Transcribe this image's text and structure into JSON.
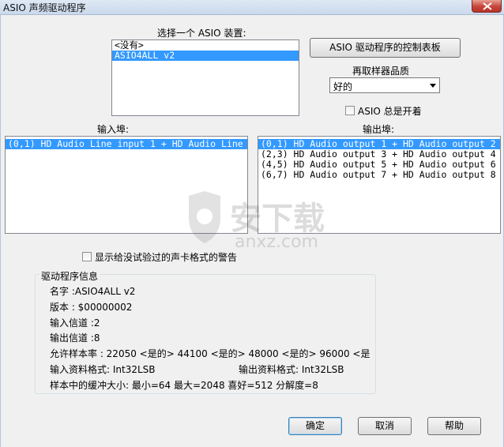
{
  "window": {
    "title": "ASIO 声频驱动程序"
  },
  "device": {
    "label": "选择一个 ASIO 装置:",
    "items": [
      "<没有>",
      "ASIO4ALL v2"
    ],
    "selected_index": 1
  },
  "control_panel_button": "ASIO 驱动程序的控制表板",
  "resample": {
    "label": "再取样器品质",
    "value": "好的"
  },
  "asio_always_on": {
    "label": "ASIO 总是开着",
    "checked": false
  },
  "input_ports": {
    "label": "输入埠:",
    "items": [
      "(0,1) HD Audio Line input 1 + HD Audio Line"
    ],
    "selected_index": 0
  },
  "output_ports": {
    "label": "输出埠:",
    "items": [
      "(0,1) HD Audio output 1 + HD Audio output 2",
      "(2,3) HD Audio output 3 + HD Audio output 4",
      "(4,5) HD Audio output 5 + HD Audio output 6",
      "(6,7) HD Audio output 7 + HD Audio output 8"
    ],
    "selected_index": 0
  },
  "show_untested_formats": {
    "label": "显示给没试验过的声卡格式的警告",
    "checked": false
  },
  "driver_info": {
    "title": "驱动程序信息",
    "name": "名字 :ASIO4ALL v2",
    "version": "版本 : $00000002",
    "input_channels": "输入信道 :2",
    "output_channels": "输出信道 :8",
    "sample_rates": "允许样本率 : 22050 <是的> 44100 <是的> 48000 <是的> 96000 <是",
    "input_format": "输入资料格式: Int32LSB",
    "output_format": "输出资料格式: Int32LSB",
    "buffer_sizes": "样本中的缓冲大小: 最小=64 最大=2048 喜好=512 分解度=8"
  },
  "buttons": {
    "ok": "确定",
    "cancel": "取消",
    "help": "帮助"
  },
  "watermark": {
    "text": "安下载",
    "domain": "anxz.com"
  },
  "colors": {
    "selection": "#3399ff",
    "dialog_bg": "#f0f0f0",
    "close_red": "#c7443a"
  },
  "icons": {
    "close": "close-icon",
    "dropdown": "chevron-down-icon"
  }
}
